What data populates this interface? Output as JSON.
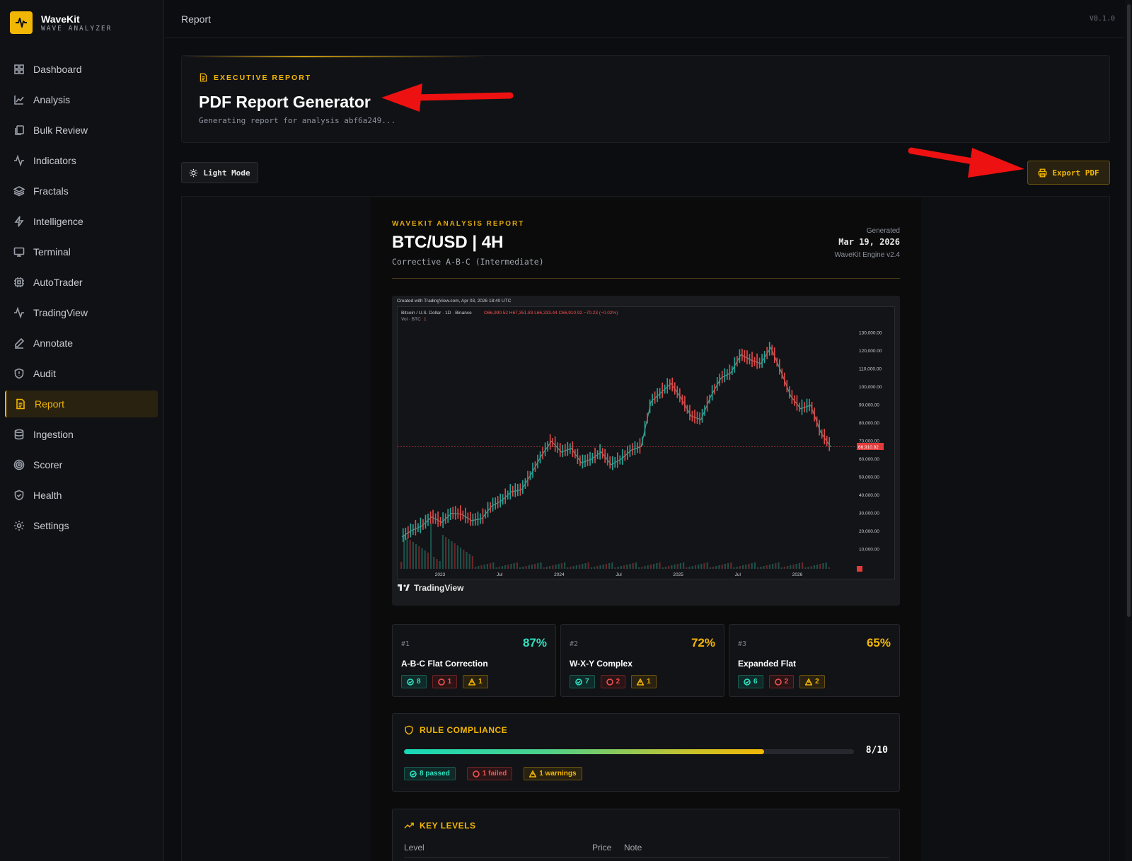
{
  "brand": {
    "name": "WaveKit",
    "subtitle": "WAVE ANALYZER"
  },
  "nav": [
    {
      "label": "Dashboard",
      "icon": "grid-icon"
    },
    {
      "label": "Analysis",
      "icon": "line-chart-icon"
    },
    {
      "label": "Bulk Review",
      "icon": "copy-icon"
    },
    {
      "label": "Indicators",
      "icon": "activity-icon"
    },
    {
      "label": "Fractals",
      "icon": "layers-icon"
    },
    {
      "label": "Intelligence",
      "icon": "zap-icon"
    },
    {
      "label": "Terminal",
      "icon": "monitor-icon"
    },
    {
      "label": "AutoTrader",
      "icon": "cpu-icon"
    },
    {
      "label": "TradingView",
      "icon": "activity-icon"
    },
    {
      "label": "Annotate",
      "icon": "pen-icon"
    },
    {
      "label": "Audit",
      "icon": "shield-icon"
    },
    {
      "label": "Report",
      "icon": "file-text-icon",
      "active": true
    },
    {
      "label": "Ingestion",
      "icon": "database-icon"
    },
    {
      "label": "Scorer",
      "icon": "target-icon"
    },
    {
      "label": "Health",
      "icon": "shield-check-icon"
    },
    {
      "label": "Settings",
      "icon": "gear-icon"
    }
  ],
  "topbar": {
    "title": "Report",
    "version": "V8.1.0"
  },
  "hero": {
    "kicker": "EXECUTIVE REPORT",
    "title": "PDF Report Generator",
    "subtitle": "Generating report for analysis abf6a249..."
  },
  "actions": {
    "light_mode": "Light Mode",
    "export_pdf": "Export PDF"
  },
  "report": {
    "kicker": "WAVEKIT ANALYSIS REPORT",
    "title": "BTC/USD | 4H",
    "pattern": "Corrective A-B-C (Intermediate)",
    "generated_label": "Generated",
    "generated_date": "Mar 19, 2026",
    "engine": "WaveKit Engine v2.4"
  },
  "chart": {
    "created": "Created with TradingView.com, Apr 03, 2026 18:40 UTC",
    "symbol_line": "Bitcoin / U.S. Dollar · 1D · Binance",
    "ohlc": "O66,990.52 H67,351.83 L66,333.44 C66,910.92 −70.23 (−0.02%)",
    "vol_line": "Vol · BTC",
    "vol_value": "1",
    "last_price": "66,910.92",
    "watermark": "TradingView"
  },
  "chart_data": {
    "type": "line",
    "title": "Bitcoin / U.S. Dollar · 1D · Binance",
    "x": [
      "2023",
      "Jul",
      "2024",
      "Jul",
      "2025",
      "Jul",
      "2026"
    ],
    "y_ticks": [
      "130,000.00",
      "120,000.00",
      "110,000.00",
      "100,000.00",
      "90,000.00",
      "80,000.00",
      "70,000.00",
      "60,000.00",
      "50,000.00",
      "40,000.00",
      "30,000.00",
      "20,000.00",
      "10,000.00"
    ],
    "ylim": [
      0,
      135000
    ],
    "series": [
      {
        "name": "",
        "values": [
          17000,
          20500,
          23000,
          28000,
          25000,
          30000,
          29500,
          26000,
          27000,
          34000,
          37000,
          42000,
          43000,
          52000,
          62000,
          70000,
          64000,
          66000,
          58000,
          60000,
          64000,
          57000,
          60000,
          65000,
          67000,
          92000,
          97000,
          102000,
          94000,
          84000,
          82000,
          95000,
          105000,
          108000,
          118000,
          115000,
          113000,
          122000,
          109000,
          95000,
          88000,
          90000,
          75000,
          66910
        ]
      }
    ]
  },
  "patterns": [
    {
      "rank": "#1",
      "pct": "87%",
      "name": "A-B-C Flat Correction",
      "passed": "8",
      "failed": "1",
      "warnings": "1",
      "color": "#2fe0c0"
    },
    {
      "rank": "#2",
      "pct": "72%",
      "name": "W-X-Y Complex",
      "passed": "7",
      "failed": "2",
      "warnings": "1",
      "color": "#f2b705"
    },
    {
      "rank": "#3",
      "pct": "65%",
      "name": "Expanded Flat",
      "passed": "6",
      "failed": "2",
      "warnings": "2",
      "color": "#f2b705"
    }
  ],
  "compliance": {
    "title": "RULE COMPLIANCE",
    "score": "8/10",
    "fraction": 0.8,
    "passed": "8 passed",
    "failed": "1 failed",
    "warnings": "1 warnings"
  },
  "key_levels": {
    "title": "KEY LEVELS",
    "columns": [
      "Level",
      "Price",
      "Note"
    ]
  },
  "colors": {
    "accent": "#f2b705",
    "success": "#2fe0c0",
    "danger": "#f05252",
    "bg": "#0c0d10"
  }
}
